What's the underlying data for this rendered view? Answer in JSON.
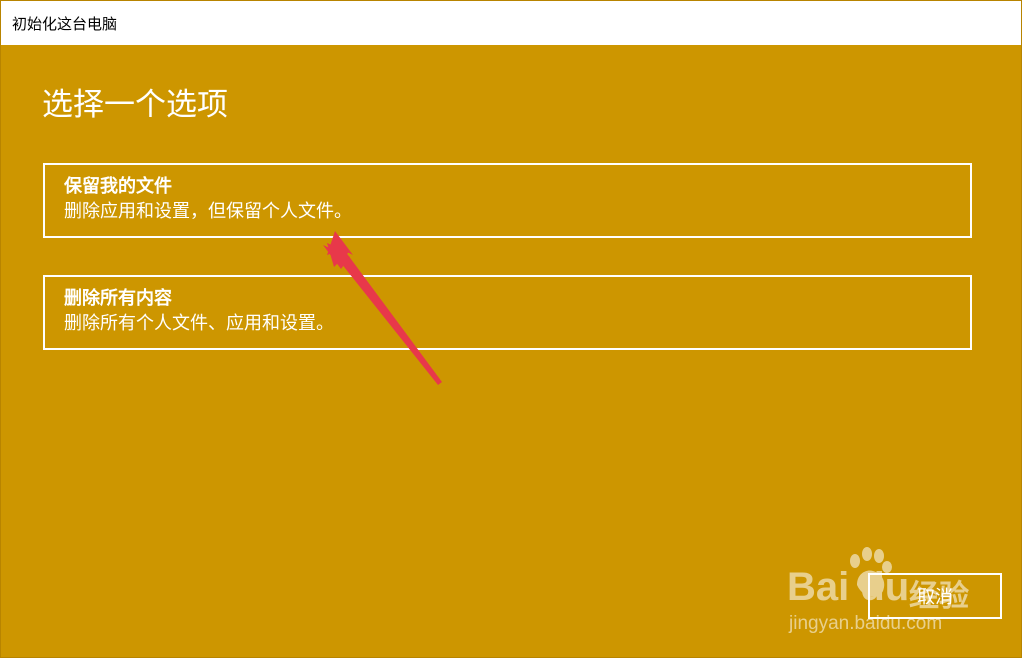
{
  "window": {
    "title": "初始化这台电脑"
  },
  "page": {
    "heading": "选择一个选项"
  },
  "options": [
    {
      "title": "保留我的文件",
      "description": "删除应用和设置，但保留个人文件。"
    },
    {
      "title": "删除所有内容",
      "description": "删除所有个人文件、应用和设置。"
    }
  ],
  "footer": {
    "cancel_label": "取消"
  },
  "watermark": {
    "brand_latin": "Bai du",
    "brand_cn": "经验",
    "url": "jingyan.baidu.com"
  },
  "colors": {
    "background": "#cd9600",
    "titlebar": "#ffffff",
    "text": "#ffffff",
    "annotation_arrow": "#e8384a"
  }
}
